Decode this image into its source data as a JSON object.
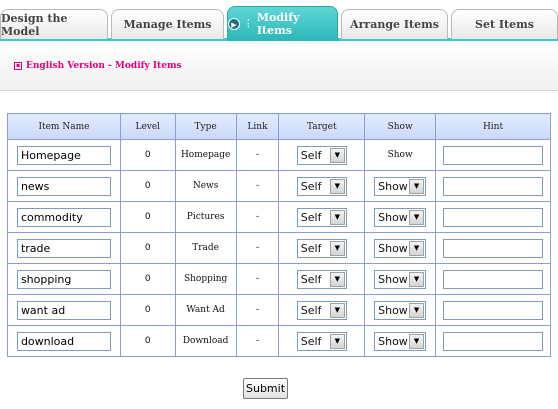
{
  "tabs": [
    {
      "label": "Design the Model"
    },
    {
      "label": "Manage Items"
    },
    {
      "label": "Modify Items"
    },
    {
      "label": "Arrange Items"
    },
    {
      "label": "Set Items"
    }
  ],
  "active_tab": "Modify Items",
  "breadcrumb": "English Version - Modify Items",
  "table": {
    "headers": [
      "Item Name",
      "Level",
      "Type",
      "Link",
      "Target",
      "Show",
      "Hint"
    ],
    "rows": [
      {
        "name": "Homepage",
        "level": "0",
        "type": "Homepage",
        "link": "-",
        "target": "Self",
        "show": "Show",
        "show_is_select": false
      },
      {
        "name": "news",
        "level": "0",
        "type": "News",
        "link": "-",
        "target": "Self",
        "show": "Show",
        "show_is_select": true
      },
      {
        "name": "commodity",
        "level": "0",
        "type": "Pictures",
        "link": "-",
        "target": "Self",
        "show": "Show",
        "show_is_select": true
      },
      {
        "name": "trade",
        "level": "0",
        "type": "Trade",
        "link": "-",
        "target": "Self",
        "show": "Show",
        "show_is_select": true
      },
      {
        "name": "shopping",
        "level": "0",
        "type": "Shopping",
        "link": "-",
        "target": "Self",
        "show": "Show",
        "show_is_select": true
      },
      {
        "name": "want ad",
        "level": "0",
        "type": "Want Ad",
        "link": "-",
        "target": "Self",
        "show": "Show",
        "show_is_select": true
      },
      {
        "name": "download",
        "level": "0",
        "type": "Download",
        "link": "-",
        "target": "Self",
        "show": "Show",
        "show_is_select": true
      }
    ]
  },
  "submit_label": "Submit",
  "colors": {
    "accent": "#3fc8c8",
    "breadcrumb": "#e0007a",
    "header_bg": "#c9d8fb",
    "border": "#8aa0d4"
  }
}
